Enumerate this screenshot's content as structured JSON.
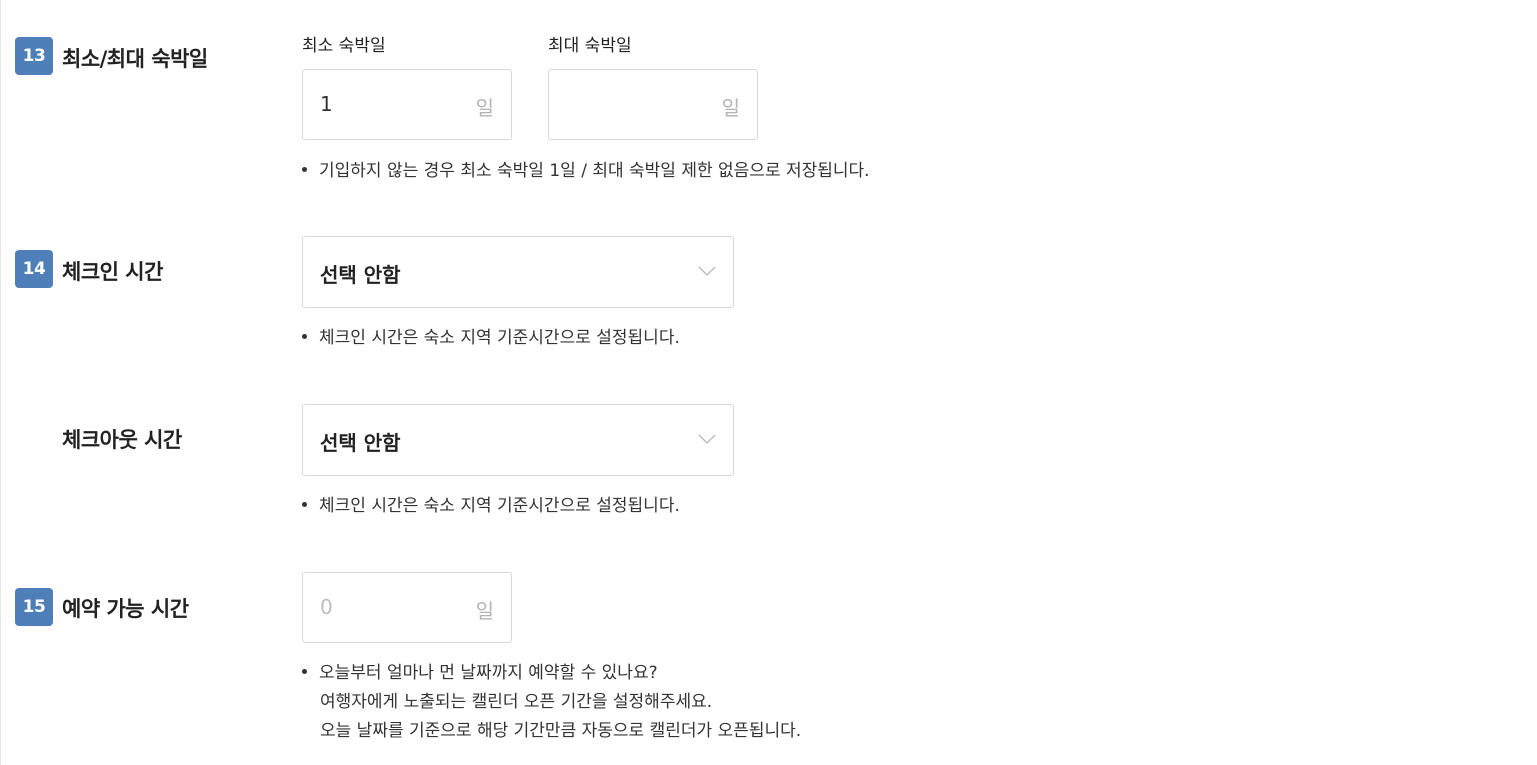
{
  "stay": {
    "badge": "13",
    "label": "최소/최대 숙박일",
    "min_label": "최소 숙박일",
    "min_value": "1",
    "min_unit": "일",
    "max_label": "최대 숙박일",
    "max_value": "",
    "max_unit": "일",
    "help": "기입하지 않는 경우 최소 숙박일 1일 / 최대 숙박일 제한 없음으로 저장됩니다."
  },
  "checkin": {
    "badge": "14",
    "label": "체크인 시간",
    "selected": "선택 안함",
    "help": "체크인 시간은 숙소 지역 기준시간으로 설정됩니다."
  },
  "checkout": {
    "label": "체크아웃 시간",
    "selected": "선택 안함",
    "help": "체크인 시간은 숙소 지역 기준시간으로 설정됩니다."
  },
  "booking": {
    "badge": "15",
    "label": "예약 가능 시간",
    "placeholder": "0",
    "unit": "일",
    "help_lines": [
      "오늘부터 얼마나 먼 날짜까지 예약할 수 있나요?",
      "여행자에게 노출되는 캘린더 오픈 기간을 설정해주세요.",
      "오늘 날짜를 기준으로 해당 기간만큼 자동으로 캘린더가 오픈됩니다."
    ]
  },
  "colors": {
    "badge": "#4f7fb9",
    "border": "#d9d9d9",
    "placeholder": "#bdbdbd"
  },
  "icons": {
    "dropdown": "chevron-down-icon"
  }
}
